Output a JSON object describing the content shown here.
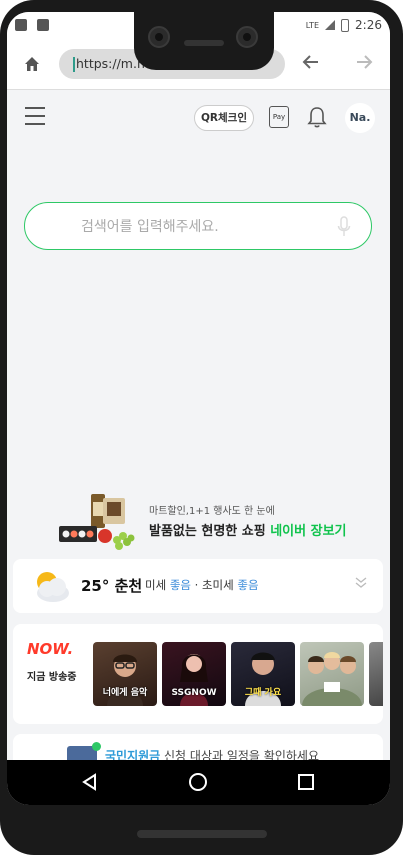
{
  "status_bar": {
    "network": "LTE",
    "time": "2:26"
  },
  "browser": {
    "url": "https://m.naver.com/",
    "home_icon": "home-icon",
    "back_icon": "arrow-left-icon",
    "forward_icon": "arrow-right-icon"
  },
  "header": {
    "qr_label": "QR체크인",
    "pay_label": "Pay",
    "avatar_label": "Na."
  },
  "search": {
    "placeholder": "검색어를 입력해주세요."
  },
  "promo": {
    "subtitle": "마트할인,1+1 행사도 한 눈에",
    "title_prefix": "발품없는 현명한 쇼핑 ",
    "title_highlight": "네이버 장보기"
  },
  "weather": {
    "temp_city": "25° 춘천",
    "dust_label": "미세",
    "dust_value": "좋음",
    "separator": " · ",
    "ultra_label": "초미세",
    "ultra_value": "좋음"
  },
  "now": {
    "logo": "NOW.",
    "label": "지금 방송중",
    "shows": [
      {
        "caption": "너에게 음악"
      },
      {
        "caption": "SSGNOW"
      },
      {
        "caption": "그때 가요"
      },
      {
        "caption": ""
      }
    ]
  },
  "bottom_card": {
    "link": "국민지원금",
    "text": " 신청 대상과 일정을 확인하세요"
  },
  "colors": {
    "naver_green": "#2ec866",
    "now_red": "#ff3a2a",
    "dust_blue": "#3c8cd9"
  }
}
